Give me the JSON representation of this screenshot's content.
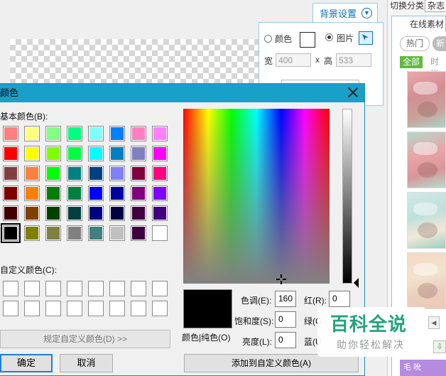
{
  "background_settings": {
    "title": "背景设置",
    "color_label": "颜色",
    "image_label": "图片",
    "width_label": "宽",
    "width_value": "400",
    "times_sign": "x",
    "height_label": "高",
    "height_value": "533",
    "mode_selected": "image"
  },
  "sidebar": {
    "switch_category_label": "切换分类",
    "category_tab": "杂志",
    "online_tab": "在线素材",
    "filter_hot": "热门",
    "filter_new": "新",
    "all_label": "全部",
    "time_label": "时尚",
    "purple_text": "毛 吮"
  },
  "color_dialog": {
    "title": "颜色",
    "basic_colors_label": "基本颜色(B):",
    "custom_colors_label": "自定义颜色(C):",
    "define_custom_button": "规定自定义颜色(D) >>",
    "ok_button": "确定",
    "cancel_button": "取消",
    "add_custom_button": "添加到自定义颜色(A)",
    "color_solid_label": "颜色|纯色(O)",
    "hue_label": "色调(E):",
    "hue_value": "160",
    "sat_label": "饱和度(S):",
    "sat_value": "0",
    "lum_label": "亮度(L):",
    "lum_value": "0",
    "red_label": "红(R):",
    "red_value": "0",
    "green_label": "绿(G",
    "blue_label": "蓝(U",
    "basic_colors": [
      "#ff8080",
      "#ffff80",
      "#80ff80",
      "#00ff80",
      "#80ffff",
      "#0080ff",
      "#ff80c0",
      "#ff80ff",
      "#ff0000",
      "#ffff00",
      "#80ff00",
      "#00ff40",
      "#00ffff",
      "#0080c0",
      "#8080c0",
      "#ff00ff",
      "#804040",
      "#ff8040",
      "#00ff00",
      "#008080",
      "#004080",
      "#8080ff",
      "#800040",
      "#ff0080",
      "#800000",
      "#ff8000",
      "#008000",
      "#008040",
      "#0000ff",
      "#0000a0",
      "#800080",
      "#8000ff",
      "#400000",
      "#804000",
      "#004000",
      "#004040",
      "#000080",
      "#000040",
      "#400040",
      "#400080",
      "#000000",
      "#808000",
      "#808040",
      "#808080",
      "#408080",
      "#c0c0c0",
      "#400040",
      "#ffffff"
    ],
    "selected_index": 40,
    "current_color": "#000000"
  },
  "watermark": {
    "main": "百科全说",
    "sub": "助你轻松解决"
  }
}
